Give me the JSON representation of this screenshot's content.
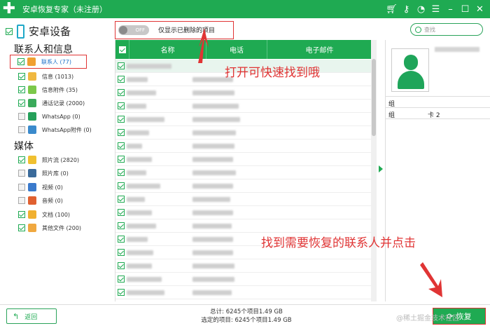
{
  "window": {
    "title": "安卓恢复专家（未注册）"
  },
  "sidebar": {
    "device_label": "安卓设备",
    "sections": [
      "联系人和信息",
      "媒体"
    ],
    "items": [
      {
        "label": "联系人 (77)",
        "icon": "contacts-icon",
        "color": "#f0a030",
        "checked": true
      },
      {
        "label": "信息 (1013)",
        "icon": "message-icon",
        "color": "#f0b840",
        "checked": true
      },
      {
        "label": "信息附件 (35)",
        "icon": "attachment-icon",
        "color": "#7cc84a",
        "checked": true
      },
      {
        "label": "通话记录 (2000)",
        "icon": "call-log-icon",
        "color": "#3aaa5a",
        "checked": true
      },
      {
        "label": "WhatsApp (0)",
        "icon": "whatsapp-icon",
        "color": "#25a05a",
        "checked": false
      },
      {
        "label": "WhatsApp附件 (0)",
        "icon": "whatsapp-attachment-icon",
        "color": "#3a8acc",
        "checked": false
      },
      {
        "label": "照片流 (2820)",
        "icon": "photo-stream-icon",
        "color": "#f0c030",
        "checked": true
      },
      {
        "label": "照片库 (0)",
        "icon": "photo-library-icon",
        "color": "#3a6a9a",
        "checked": false
      },
      {
        "label": "视频 (0)",
        "icon": "video-icon",
        "color": "#3a7acc",
        "checked": false
      },
      {
        "label": "音频 (0)",
        "icon": "audio-icon",
        "color": "#e06030",
        "checked": false
      },
      {
        "label": "文档 (100)",
        "icon": "document-icon",
        "color": "#f0b030",
        "checked": true
      },
      {
        "label": "其他文件 (200)",
        "icon": "other-files-icon",
        "color": "#f0a840",
        "checked": true
      }
    ]
  },
  "toolbar": {
    "toggle_state": "OFF",
    "toggle_label": "仅显示已删除的项目",
    "search_placeholder": "查找"
  },
  "table": {
    "columns": [
      "名称",
      "电话",
      "电子邮件"
    ],
    "row_count_visible": 19
  },
  "detail": {
    "group_label_1": "组",
    "group_label_2": "组",
    "group_value_2": "卡 2"
  },
  "annotations": {
    "top": "打开可快速找到哦",
    "bottom": "找到需要恢复的联系人并点击"
  },
  "footer": {
    "back_label": "返回",
    "total_text": "总计: 6245个项目1.49 GB",
    "selected_text": "选定的项目: 6245个项目1.49 GB",
    "recover_label": "恢复"
  },
  "watermark": "@稀土掘金技术社区",
  "colors": {
    "accent": "#1faa52",
    "annotation": "#e03434"
  }
}
